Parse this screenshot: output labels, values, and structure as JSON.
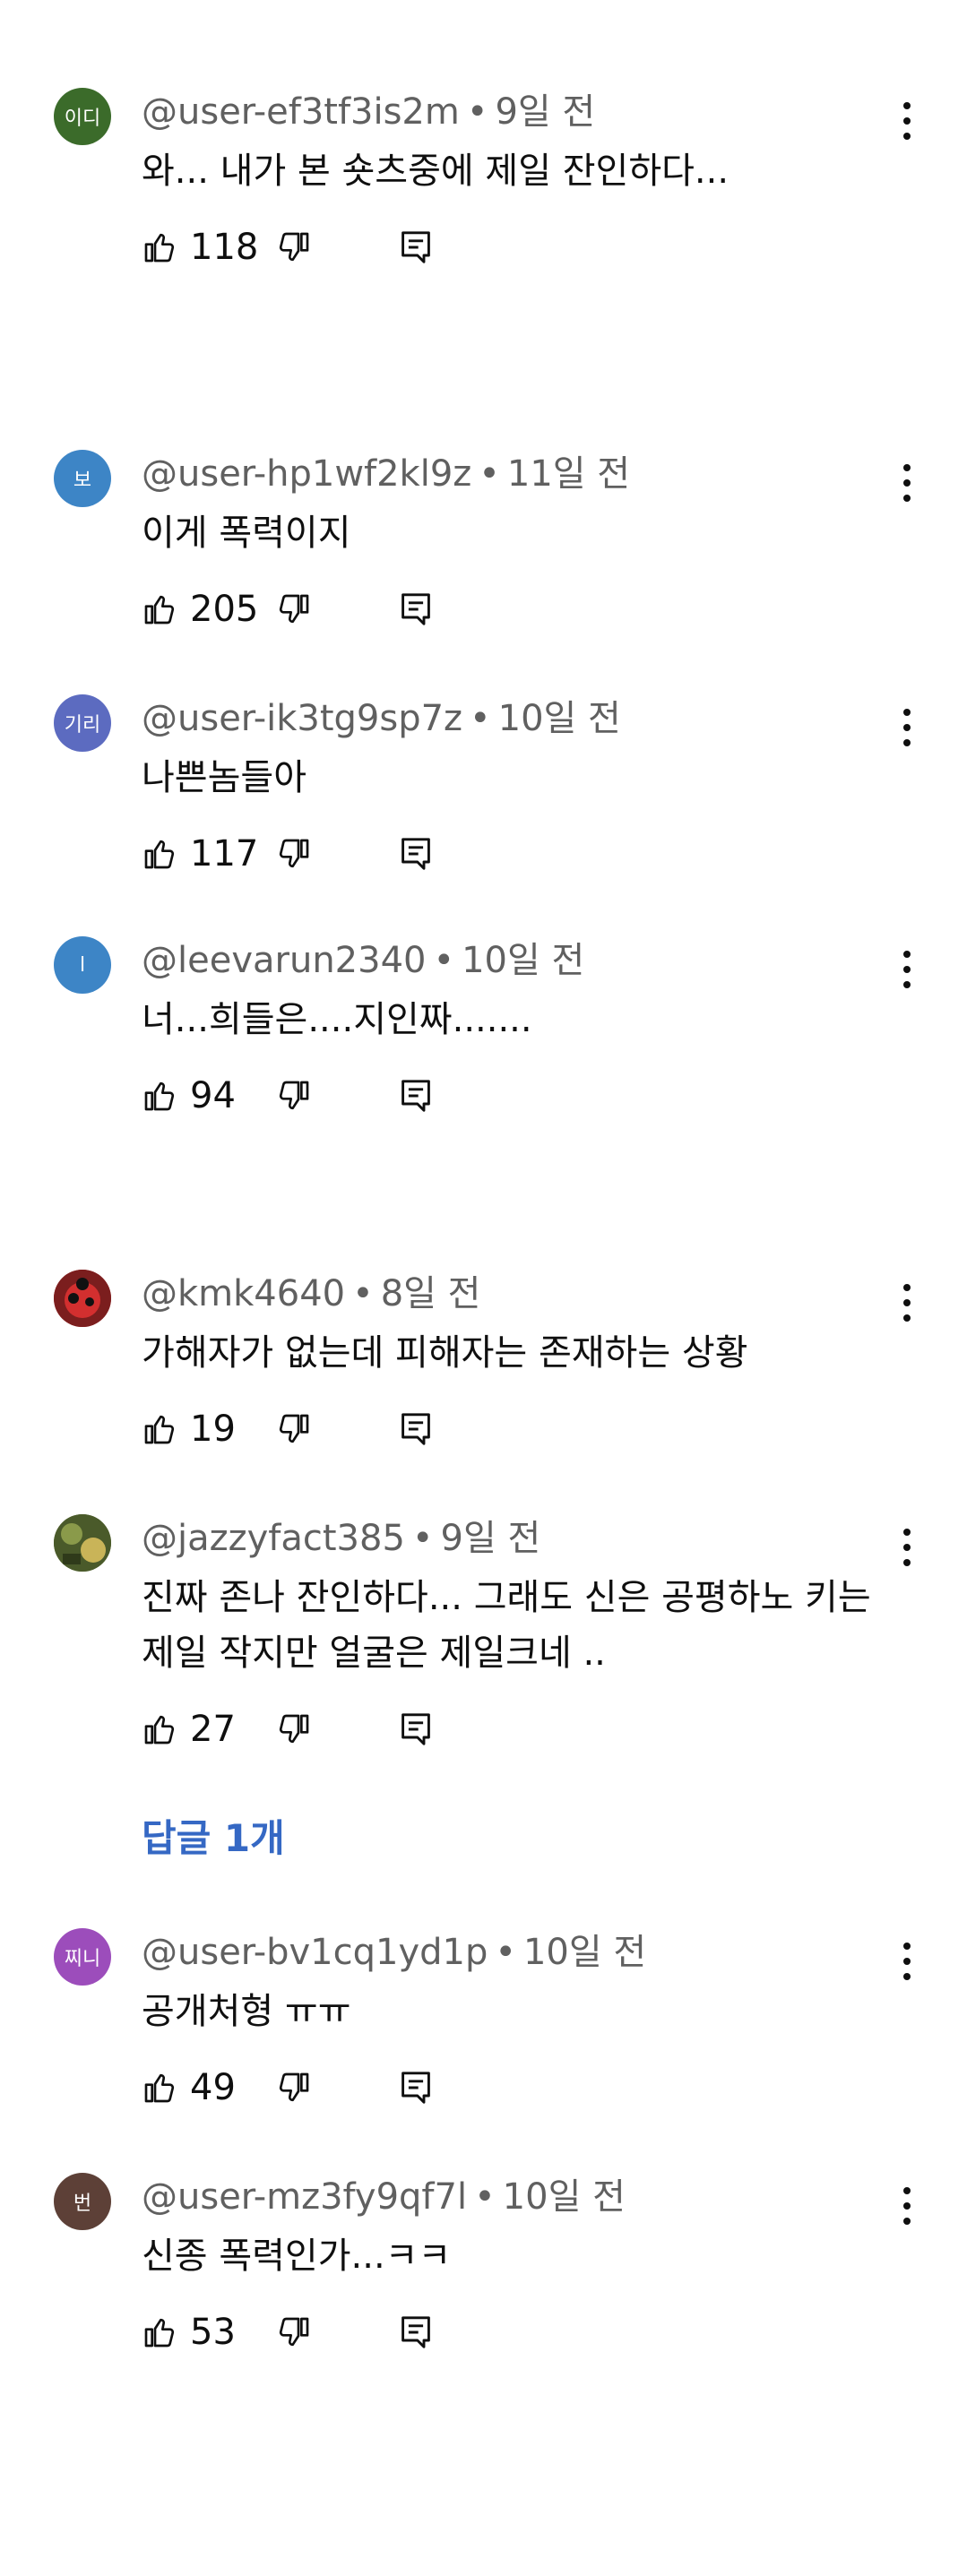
{
  "comments": [
    {
      "avatar_text": "이디",
      "avatar_color": "#3b6b2a",
      "author": "@user-ef3tf3is2m",
      "time": "9일 전",
      "text": "와... 내가 본 숏츠중에 제일 잔인하다...",
      "likes": "118"
    },
    {
      "avatar_text": "보",
      "avatar_color": "#3d85c6",
      "author": "@user-hp1wf2kl9z",
      "time": "11일 전",
      "text": "이게 폭력이지",
      "likes": "205"
    },
    {
      "avatar_text": "기리",
      "avatar_color": "#5c6bc0",
      "author": "@user-ik3tg9sp7z",
      "time": "10일 전",
      "text": "나쁜놈들아",
      "likes": "117"
    },
    {
      "avatar_text": "l",
      "avatar_color": "#3d85c6",
      "author": "@leevarun2340",
      "time": "10일 전",
      "text": "너...희들은....지인짜.......",
      "likes": "94"
    },
    {
      "avatar_text": "",
      "avatar_color": "#c62828",
      "author": "@kmk4640",
      "time": "8일 전",
      "text": "가해자가 없는데 피해자는 존재하는 상황",
      "likes": "19"
    },
    {
      "avatar_text": "",
      "avatar_color": "#6b7a3a",
      "author": "@jazzyfact385",
      "time": "9일 전",
      "text": "진짜 존나 잔인하다... 그래도 신은 공평하노 키는 제일 작지만 얼굴은 제일크네 ..",
      "likes": "27"
    },
    {
      "avatar_text": "찌니",
      "avatar_color": "#9c4dbb",
      "author": "@user-bv1cq1yd1p",
      "time": "10일 전",
      "text": "공개처형 ㅠㅠ",
      "likes": "49"
    },
    {
      "avatar_text": "번",
      "avatar_color": "#5d4037",
      "author": "@user-mz3fy9qf7l",
      "time": "10일 전",
      "text": "신종 폭력인가...ㅋㅋ",
      "likes": "53"
    }
  ],
  "replies_label": "답글 1개",
  "icons": {
    "like": "thumbs-up-icon",
    "dislike": "thumbs-down-icon",
    "reply": "reply-icon",
    "more": "kebab-menu-icon"
  }
}
